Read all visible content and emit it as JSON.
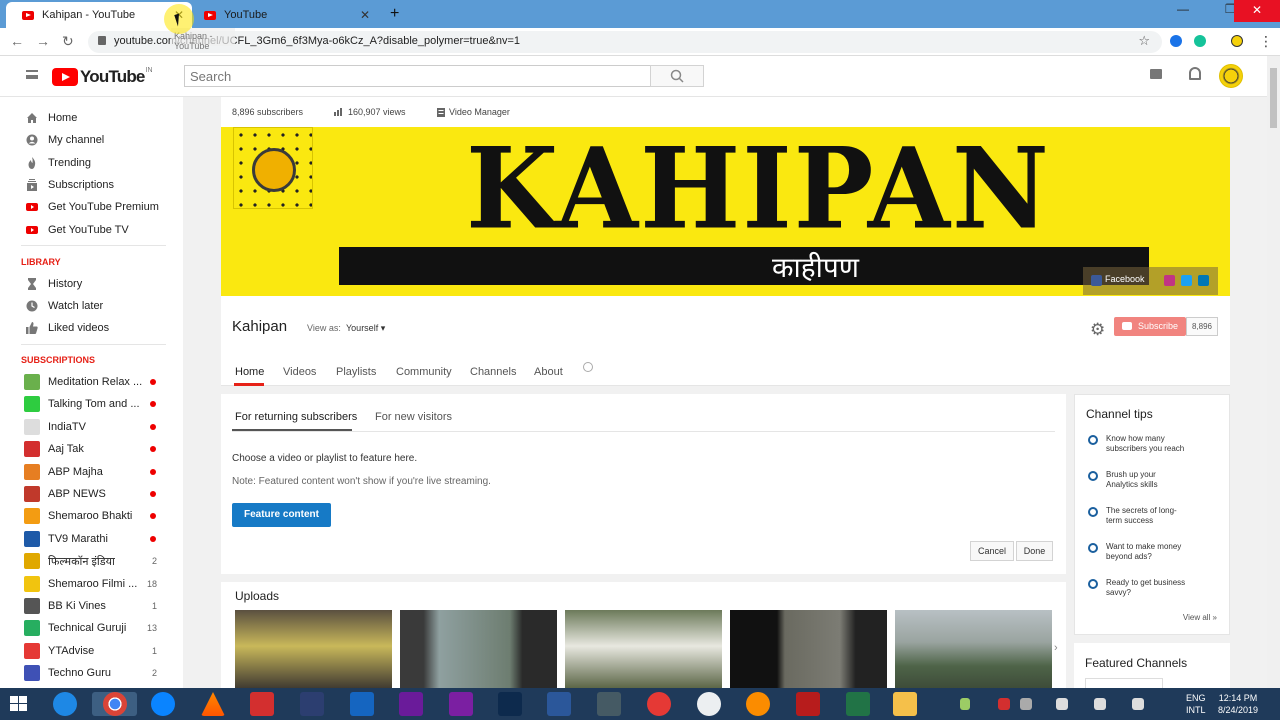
{
  "browser": {
    "tabs": [
      {
        "title": "Kahipan - YouTube",
        "close": "✕"
      },
      {
        "title": "YouTube",
        "close": "✕"
      }
    ],
    "new_tab": "+",
    "url": "youtube.com/channel/UCFL_3Gm6_6f3Mya-o6kCz_A?disable_polymer=true&nv=1",
    "tooltip": "Kahipan - YouTube",
    "window_controls": {
      "minimize": "—",
      "maximize": "❐",
      "close": "✕"
    }
  },
  "header": {
    "logo_text": "YouTube",
    "country": "IN",
    "search_placeholder": "Search"
  },
  "sidebar": {
    "main": [
      {
        "label": "Home",
        "icon": "home-icon"
      },
      {
        "label": "My channel",
        "icon": "account-icon"
      },
      {
        "label": "Trending",
        "icon": "flame-icon"
      },
      {
        "label": "Subscriptions",
        "icon": "subscriptions-icon"
      },
      {
        "label": "Get YouTube Premium",
        "icon": "youtube-red-icon"
      },
      {
        "label": "Get YouTube TV",
        "icon": "youtube-red-icon"
      }
    ],
    "library_heading": "LIBRARY",
    "library": [
      {
        "label": "History",
        "icon": "hourglass-icon"
      },
      {
        "label": "Watch later",
        "icon": "clock-icon"
      },
      {
        "label": "Liked videos",
        "icon": "thumb-up-icon"
      }
    ],
    "subscriptions_heading": "SUBSCRIPTIONS",
    "subscriptions": [
      {
        "label": "Meditation Relax ...",
        "badge": "",
        "dot": true,
        "color": "#6ab04c"
      },
      {
        "label": "Talking Tom and ...",
        "badge": "",
        "dot": true,
        "color": "#2ecc40"
      },
      {
        "label": "IndiaTV",
        "badge": "",
        "dot": true,
        "color": "#dddddd"
      },
      {
        "label": "Aaj Tak",
        "badge": "",
        "dot": true,
        "color": "#d32f2f"
      },
      {
        "label": "ABP Majha",
        "badge": "",
        "dot": true,
        "color": "#e67e22"
      },
      {
        "label": "ABP NEWS",
        "badge": "",
        "dot": true,
        "color": "#c0392b"
      },
      {
        "label": "Shemaroo Bhakti",
        "badge": "",
        "dot": true,
        "color": "#f39c12"
      },
      {
        "label": "TV9 Marathi",
        "badge": "",
        "dot": true,
        "color": "#1e5aa8"
      },
      {
        "label": "फिल्मकॉन इंडिया",
        "badge": "2",
        "dot": false,
        "color": "#e0a800"
      },
      {
        "label": "Shemaroo Filmi ...",
        "badge": "18",
        "dot": false,
        "color": "#f1c40f"
      },
      {
        "label": "BB Ki Vines",
        "badge": "1",
        "dot": false,
        "color": "#555555"
      },
      {
        "label": "Technical Guruji",
        "badge": "13",
        "dot": false,
        "color": "#27ae60"
      },
      {
        "label": "YTAdvise",
        "badge": "1",
        "dot": false,
        "color": "#e53935"
      },
      {
        "label": "Techno Guru",
        "badge": "2",
        "dot": false,
        "color": "#3f51b5"
      }
    ]
  },
  "channel": {
    "subscribers": "8,896 subscribers",
    "views": "160,907 views",
    "video_manager": "Video Manager",
    "banner_title": "KAHIPAN",
    "banner_subtitle": "काहीपण",
    "facebook": "Facebook",
    "name": "Kahipan",
    "view_as_label": "View as:",
    "view_as_value": "Yourself ▾",
    "subscribe": "Subscribe",
    "subscribe_count": "8,896",
    "tabs": [
      "Home",
      "Videos",
      "Playlists",
      "Community",
      "Channels",
      "About"
    ]
  },
  "feature": {
    "tabs": [
      "For returning subscribers",
      "For new visitors"
    ],
    "description": "Choose a video or playlist to feature here.",
    "note": "Note: Featured content won't show if you're live streaming.",
    "button": "Feature content",
    "cancel": "Cancel",
    "done": "Done"
  },
  "uploads": {
    "heading": "Uploads",
    "next": "›"
  },
  "tips": {
    "heading": "Channel tips",
    "items": [
      "Know how many subscribers you reach",
      "Brush up your Analytics skills",
      "The secrets of long-term success",
      "Want to make money beyond ads?",
      "Ready to get business savvy?"
    ],
    "view_all": "View all »"
  },
  "featured_channels": {
    "heading": "Featured Channels"
  },
  "taskbar": {
    "language": "ENG",
    "layout": "INTL",
    "time": "12:14 PM",
    "date": "8/24/2019"
  }
}
